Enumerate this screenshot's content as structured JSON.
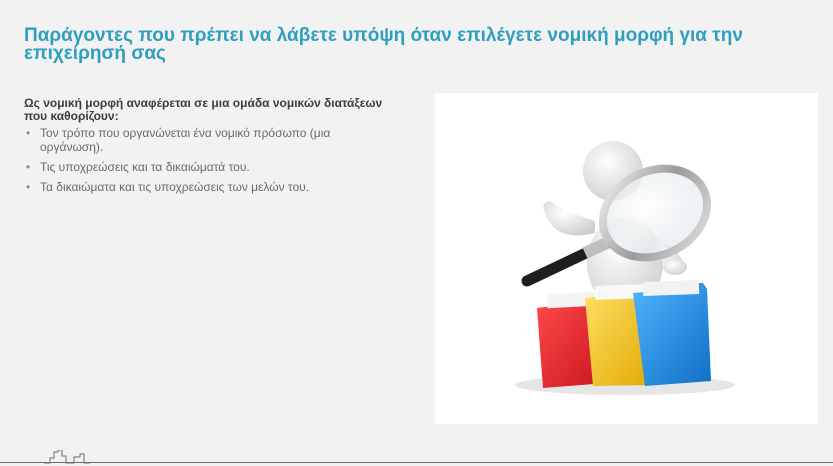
{
  "slide": {
    "title": "Παράγοντες που πρέπει να λάβετε υπόψη όταν επιλέγετε νομική μορφή για την επιχείρησή σας",
    "intro": "Ως νομική μορφή αναφέρεται σε μια ομάδα νομικών διατάξεων που καθορίζουν:",
    "bullets": [
      "Τον τρόπο που οργανώνεται ένα νομικό πρόσωπο (μια οργάνωση).",
      "Τις υποχρεώσεις και τα δικαιώματά του.",
      "Τα δικαιώματα και τις υποχρεώσεις των μελών του."
    ]
  },
  "illustration": {
    "icon": "magnifier-figure-folders-icon",
    "folder_colors": [
      "#e8262f",
      "#f2c41a",
      "#1f8ee6"
    ]
  },
  "colors": {
    "title": "#2e9fbf",
    "background": "#f2f2f2"
  },
  "footer": {
    "logo_icon": "buildings-logo-icon"
  }
}
